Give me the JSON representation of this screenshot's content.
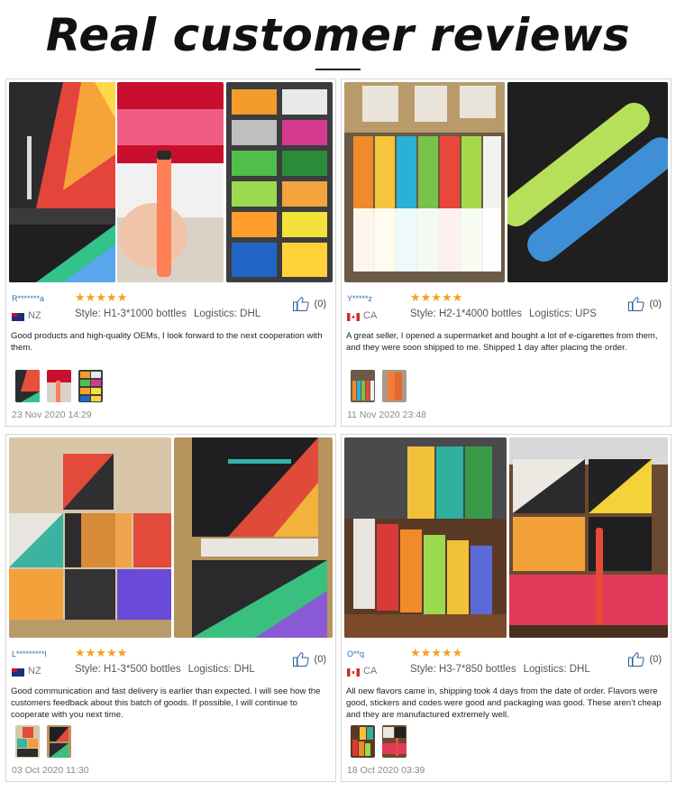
{
  "page": {
    "title": "Real customer reviews"
  },
  "colors": {
    "star": "#f4a11b",
    "accent_blue": "#2a6fbb"
  },
  "reviews": [
    {
      "user": "R*******a",
      "country": "NZ",
      "rating": 5,
      "stars": "★★★★★",
      "style": "Style: H1-3*1000 bottles",
      "logistics": "Logistics: DHL",
      "likes": "(0)",
      "comment": "Good products and high-quality OEMs, I look forward to the next cooperation with them.",
      "date": "23 Nov 2020 14:29"
    },
    {
      "user": "Y*****z",
      "country": "CA",
      "rating": 5,
      "stars": "★★★★★",
      "style": "Style: H2-1*4000 bottles",
      "logistics": "Logistics: UPS",
      "likes": "(0)",
      "comment": "A great seller, I opened a supermarket and bought a lot of e-cigarettes from them, and they were soon shipped to me. Shipped 1 day after placing the order.",
      "date": "11 Nov 2020 23:48"
    },
    {
      "user": "L*********l",
      "country": "NZ",
      "rating": 5,
      "stars": "★★★★★",
      "style": "Style: H1-3*500 bottles",
      "logistics": "Logistics: DHL",
      "likes": "(0)",
      "comment": "Good communication and fast delivery is earlier than expected. I will see how the customers feedback about this batch of goods. If possible, I will continue to cooperate with you next time.",
      "date": "03 Oct 2020 11:30"
    },
    {
      "user": "O**q",
      "country": "CA",
      "rating": 5,
      "stars": "★★★★★",
      "style": "Style: H3-7*850 bottles",
      "logistics": "Logistics: DHL",
      "likes": "(0)",
      "comment": "All new flavors came in, shipping took 4 days from the date of order. Flavors were good, stickers and codes were good and packaging was good. These aren’t cheap and they are manufactured extremely well.",
      "date": "18 Oct 2020 03:39"
    }
  ]
}
